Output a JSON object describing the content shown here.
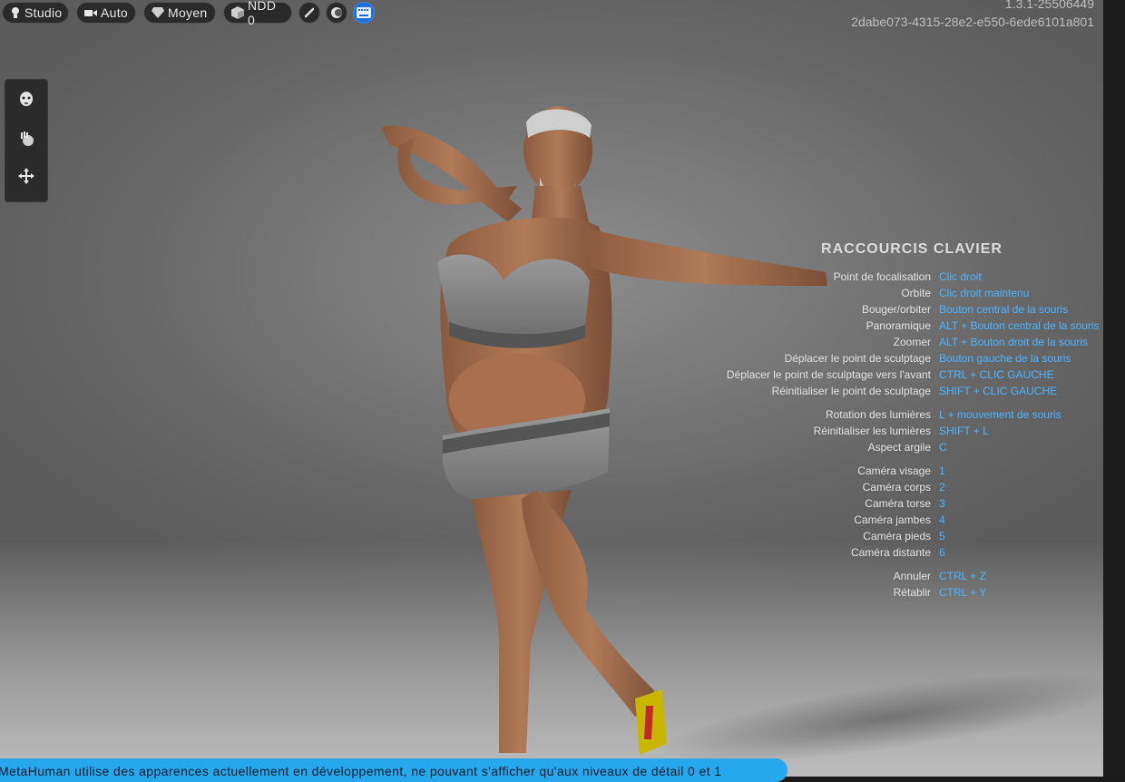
{
  "toolbar": {
    "studio_label": "Studio",
    "auto_label": "Auto",
    "quality_label": "Moyen",
    "lod_label": "NDD 0"
  },
  "version": {
    "line1": "1.3.1-25506449",
    "line2": "2dabe073-4315-28e2-e550-6ede6101a801"
  },
  "shortcuts": {
    "title": "RACCOURCIS CLAVIER",
    "items": [
      {
        "label": "Point de focalisation",
        "key": "Clic droit"
      },
      {
        "label": "Orbite",
        "key": "Clic droit maintenu"
      },
      {
        "label": "Bouger/orbiter",
        "key": "Bouton central de la souris"
      },
      {
        "label": "Panoramique",
        "key": "ALT + Bouton central de la souris"
      },
      {
        "label": "Zoomer",
        "key": "ALT + Bouton droit de la souris"
      },
      {
        "label": "Déplacer le point de sculptage",
        "key": "Bouton gauche de la souris"
      },
      {
        "label": "Déplacer le point de sculptage vers l'avant",
        "key": "CTRL + CLIC GAUCHE"
      },
      {
        "label": "Réinitialiser le point de sculptage",
        "key": "SHIFT + CLIC GAUCHE"
      },
      {
        "label": "Rotation des lumières",
        "key": "L + mouvement de souris"
      },
      {
        "label": "Réinitialiser les lumières",
        "key": "SHIFT + L"
      },
      {
        "label": "Aspect argile",
        "key": "C"
      },
      {
        "label": "Caméra visage",
        "key": "1"
      },
      {
        "label": "Caméra corps",
        "key": "2"
      },
      {
        "label": "Caméra torse",
        "key": "3"
      },
      {
        "label": "Caméra jambes",
        "key": "4"
      },
      {
        "label": "Caméra pieds",
        "key": "5"
      },
      {
        "label": "Caméra distante",
        "key": "6"
      },
      {
        "label": "Annuler",
        "key": "CTRL + Z"
      },
      {
        "label": "Rétablir",
        "key": "CTRL + Y"
      }
    ]
  },
  "banner": {
    "text": "MetaHuman utilise des apparences actuellement en développement, ne pouvant s'afficher qu'aux niveaux de détail 0 et 1"
  },
  "icons": {
    "studio": "light-bulb-icon",
    "auto": "camera-icon",
    "quality": "diamond-icon",
    "lod": "cube-icon",
    "round1": "brush-icon",
    "round2": "head-lighting-icon",
    "round3": "keyboard-icon",
    "left1": "face-icon",
    "left2": "sculpt-hand-icon",
    "left3": "move-icon"
  },
  "colors": {
    "accent": "#1e6fd9",
    "shortcut_key": "#4fb3ff",
    "banner": "#26a8ef"
  }
}
